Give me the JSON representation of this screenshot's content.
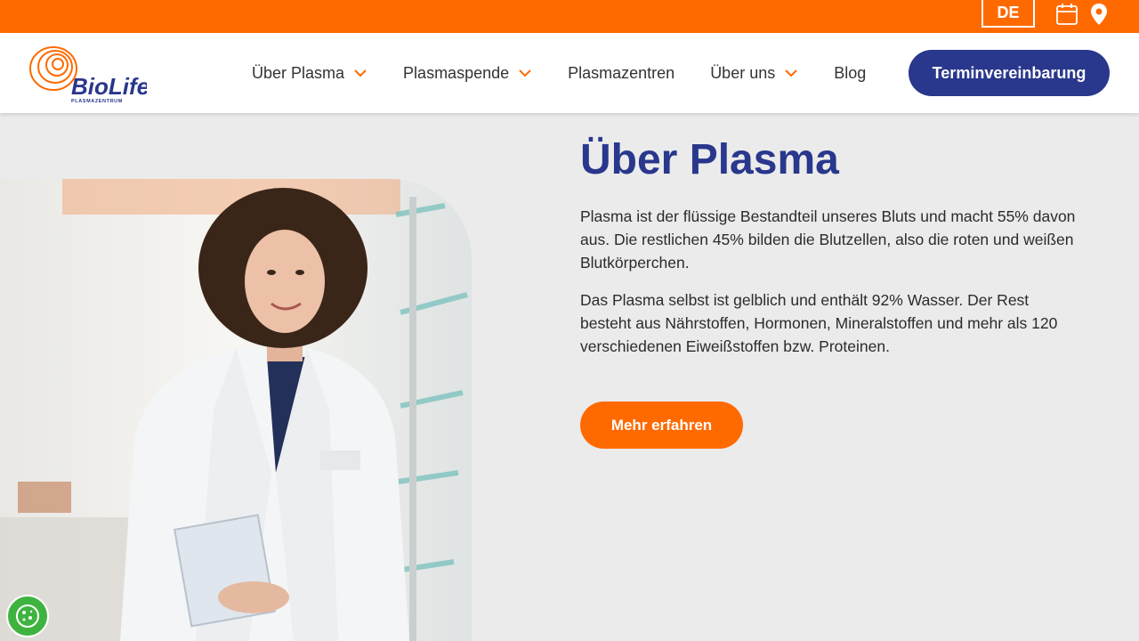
{
  "topbar": {
    "language_label": "DE",
    "icons": [
      "calendar-icon",
      "map-pin-icon"
    ]
  },
  "brand": {
    "name": "BioLife",
    "subtitle": "PLASMAZENTRUM"
  },
  "nav": {
    "items": [
      {
        "label": "Über Plasma",
        "has_dropdown": true
      },
      {
        "label": "Plasmaspende",
        "has_dropdown": true
      },
      {
        "label": "Plasmazentren",
        "has_dropdown": false
      },
      {
        "label": "Über uns",
        "has_dropdown": true
      },
      {
        "label": "Blog",
        "has_dropdown": false
      }
    ],
    "cta_label": "Terminvereinbarung"
  },
  "main": {
    "title": "Über Plasma",
    "paragraphs": [
      "Plasma ist der flüssige Bestandteil unseres Bluts und macht 55% davon aus. Die restlichen 45% bilden die Blutzellen, also die roten und weißen Blutkörperchen.",
      "Das Plasma selbst ist gelblich und enthält 92% Wasser. Der Rest besteht aus Nährstoffen, Hormonen, Mineralstoffen und mehr als 120 verschiedenen Eiweißstoffen bzw. Proteinen."
    ],
    "button_label": "Mehr erfahren"
  },
  "colors": {
    "accent_orange": "#ff6a00",
    "brand_blue": "#29378c",
    "background": "#ebebeb",
    "cookie_green": "#3fb340"
  }
}
